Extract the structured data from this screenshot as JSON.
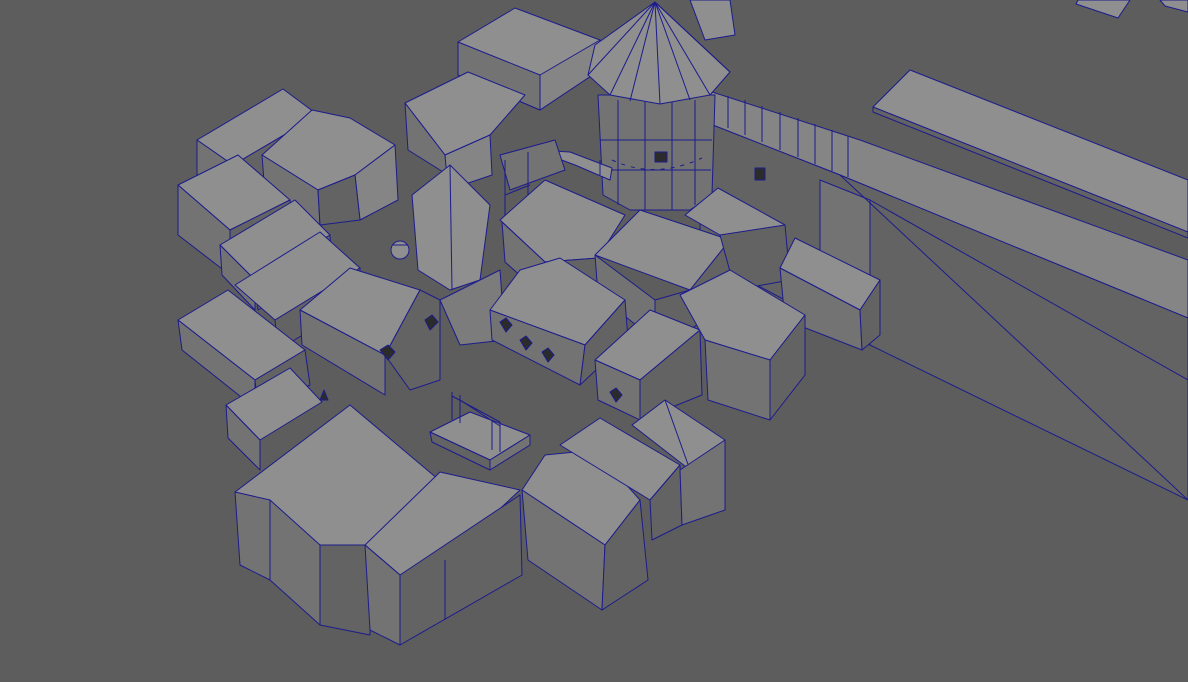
{
  "viewport": {
    "kind": "3d-perspective-viewport",
    "display_mode": "shaded-wireframe-on-shaded",
    "background_color": "#5d5d5d",
    "wire_color": "#1c1c8c",
    "surface_color": "#8f8f8f"
  },
  "scene": {
    "description_objects": [
      "castle-wall",
      "round-tower",
      "village-houses",
      "well",
      "market-stall",
      "loose-plank"
    ]
  }
}
